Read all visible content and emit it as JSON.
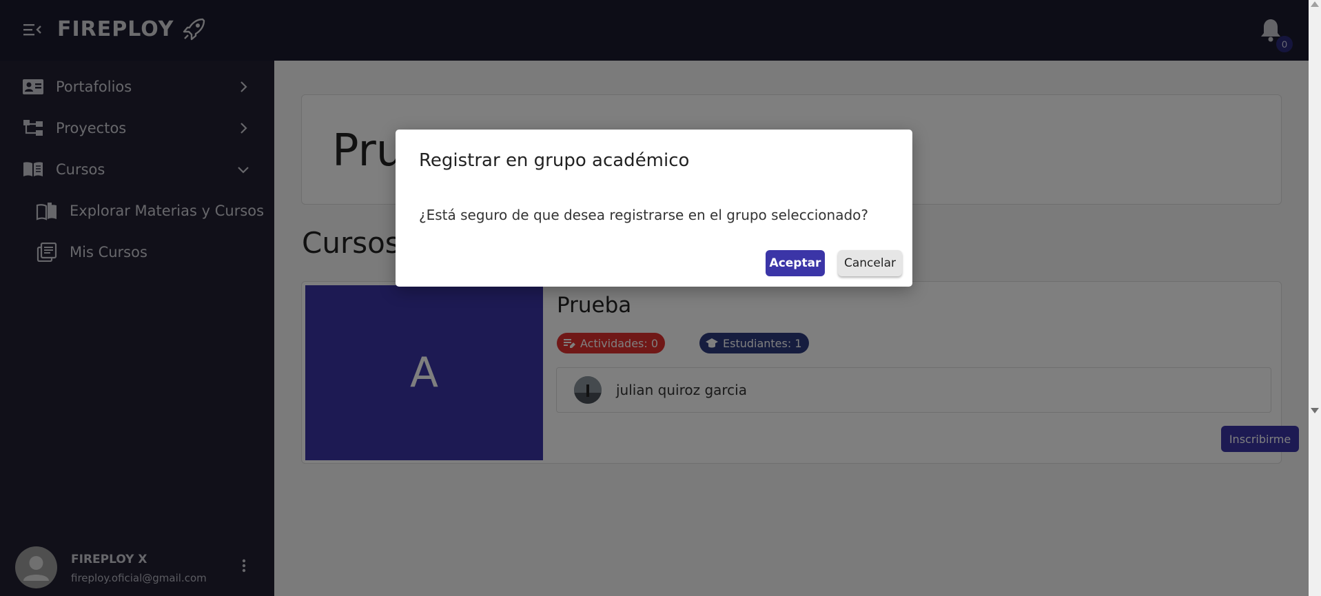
{
  "brand": {
    "name": "FIREPLOY"
  },
  "notifications": {
    "count": "0"
  },
  "sidebar": {
    "items": [
      {
        "label": "Portafolios",
        "icon": "portfolio-card-icon",
        "expanded": false
      },
      {
        "label": "Proyectos",
        "icon": "project-tree-icon",
        "expanded": false
      },
      {
        "label": "Cursos",
        "icon": "book-icon",
        "expanded": true
      }
    ],
    "sub_items": [
      {
        "label": "Explorar Materias y Cursos",
        "icon": "explore-book-icon"
      },
      {
        "label": "Mis Cursos",
        "icon": "library-icon"
      }
    ],
    "user": {
      "name": "FIREPLOY X",
      "email": "fireploy.oficial@gmail.com"
    }
  },
  "main": {
    "hero_title": "Pru",
    "section_title": "Cursos",
    "course": {
      "thumb_letter": "A",
      "name": "Prueba",
      "activities": "Actividades: 0",
      "students": "Estudiantes: 1",
      "teacher": "julian quiroz garcia",
      "enroll_label": "Inscribirme"
    }
  },
  "dialog": {
    "title": "Registrar en grupo académico",
    "message": "¿Está seguro de que desea registrarse en el grupo seleccionado?",
    "accept_label": "Aceptar",
    "cancel_label": "Cancelar"
  },
  "colors": {
    "topbar": "#1b1a2e",
    "sidebar": "#222133",
    "accent": "#3b35a7",
    "chip_red": "#e0312f",
    "chip_blue": "#2d3b7e"
  }
}
